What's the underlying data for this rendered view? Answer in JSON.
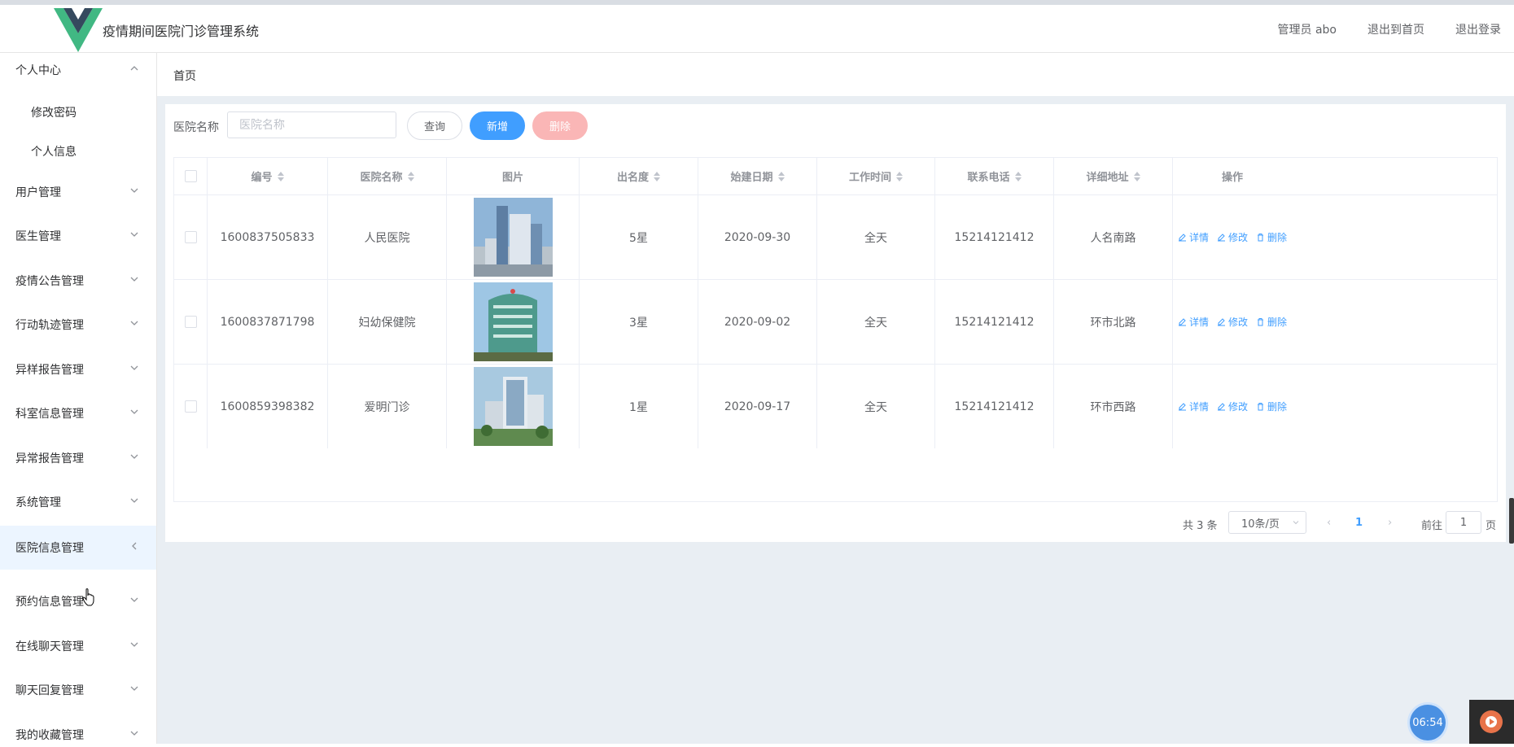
{
  "header": {
    "app_title": "疫情期间医院门诊管理系统",
    "admin_label": "管理员 abo",
    "exit_to_home": "退出到首页",
    "logout": "退出登录",
    "logo_colors": {
      "outer": "#41b883",
      "inner": "#35495e"
    }
  },
  "sidebar": {
    "items": [
      {
        "label": "个人中心",
        "type": "group-open"
      },
      {
        "label": "修改密码",
        "type": "sub"
      },
      {
        "label": "个人信息",
        "type": "sub"
      },
      {
        "label": "用户管理",
        "type": "group"
      },
      {
        "label": "医生管理",
        "type": "group"
      },
      {
        "label": "疫情公告管理",
        "type": "group"
      },
      {
        "label": "行动轨迹管理",
        "type": "group"
      },
      {
        "label": "异样报告管理",
        "type": "group"
      },
      {
        "label": "科室信息管理",
        "type": "group"
      },
      {
        "label": "异常报告管理",
        "type": "group"
      },
      {
        "label": "系统管理",
        "type": "group"
      },
      {
        "label": "医院信息管理",
        "type": "active"
      },
      {
        "label": "预约信息管理",
        "type": "group"
      },
      {
        "label": "在线聊天管理",
        "type": "group"
      },
      {
        "label": "聊天回复管理",
        "type": "group"
      },
      {
        "label": "我的收藏管理",
        "type": "group"
      }
    ]
  },
  "breadcrumb": {
    "home": "首页"
  },
  "search": {
    "label": "医院名称",
    "placeholder": "医院名称",
    "query_button": "查询",
    "add_button": "新增",
    "delete_button": "删除"
  },
  "table": {
    "columns": [
      "编号",
      "医院名称",
      "图片",
      "出名度",
      "始建日期",
      "工作时间",
      "联系电话",
      "详细地址",
      "操作"
    ],
    "rows": [
      {
        "id": "1600837505833",
        "name": "人民医院",
        "fame": "5星",
        "built": "2020-09-30",
        "hours": "全天",
        "phone": "15214121412",
        "address": "人名南路"
      },
      {
        "id": "1600837871798",
        "name": "妇幼保健院",
        "fame": "3星",
        "built": "2020-09-02",
        "hours": "全天",
        "phone": "15214121412",
        "address": "环市北路"
      },
      {
        "id": "1600859398382",
        "name": "爱明门诊",
        "fame": "1星",
        "built": "2020-09-17",
        "hours": "全天",
        "phone": "15214121412",
        "address": "环市西路"
      }
    ],
    "ops": {
      "detail": "详情",
      "edit": "修改",
      "delete": "删除"
    }
  },
  "pagination": {
    "total": "共 3 条",
    "page_size": "10条/页",
    "current_page": "1",
    "goto_label": "前往",
    "goto_value": "1",
    "page_suffix": "页"
  },
  "overlay": {
    "timer": "06:54"
  },
  "colors": {
    "primary": "#409eff",
    "danger_disabled": "#fab6b6",
    "main_bg": "#e9eef3",
    "active_menu_bg": "#ecf5ff"
  }
}
